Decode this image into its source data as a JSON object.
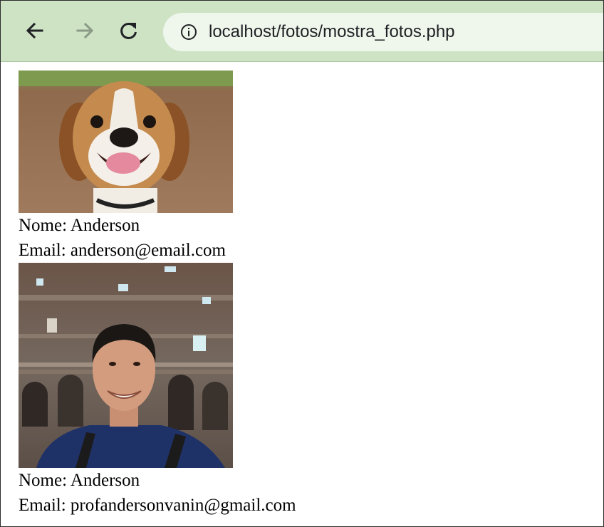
{
  "browser": {
    "url": "localhost/fotos/mostra_fotos.php",
    "icons": {
      "back": "arrow-left-icon",
      "forward": "arrow-right-icon",
      "reload": "reload-icon",
      "site_info": "info-icon"
    },
    "colors": {
      "toolbar_bg": "#cde3c4",
      "omnibox_bg": "#eff6ec"
    }
  },
  "records": [
    {
      "photo": "beagle-dog-photo",
      "name_text": "Nome: Anderson",
      "email_text": "Email: anderson@email.com"
    },
    {
      "photo": "man-at-colosseum-photo",
      "name_text": "Nome: Anderson",
      "email_text": "Email: profandersonvanin@gmail.com"
    }
  ]
}
